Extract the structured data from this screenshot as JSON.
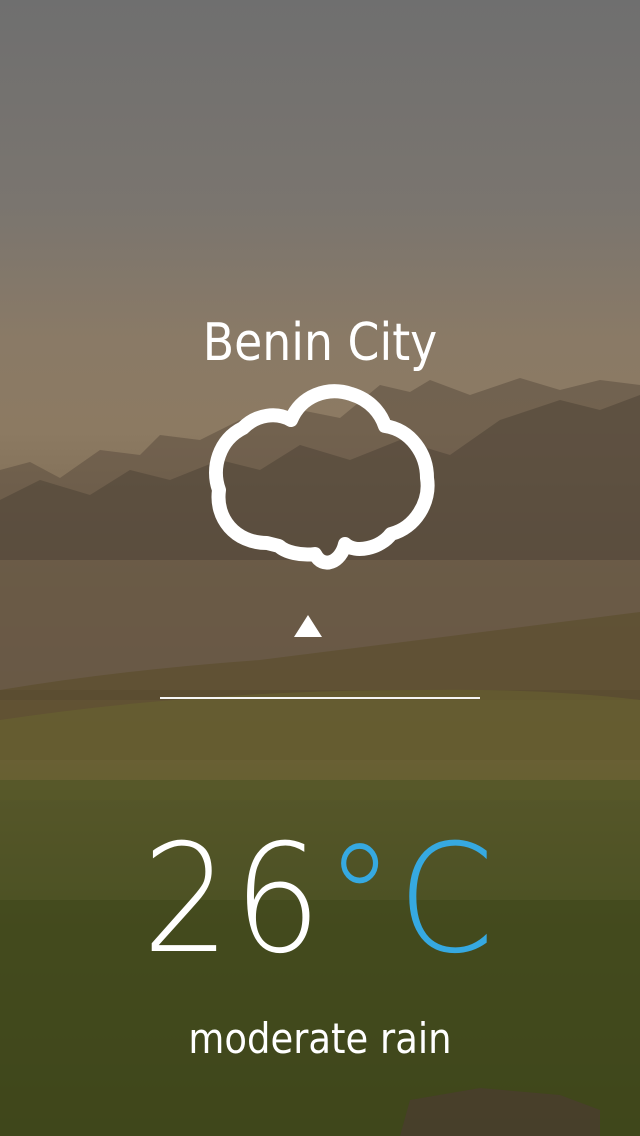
{
  "location": {
    "city": "Benin City"
  },
  "weather": {
    "icon": "cloud-icon",
    "temperature": "26",
    "unit": "°C",
    "condition": "moderate rain"
  },
  "colors": {
    "text": "#ffffff",
    "unit_accent": "#36a9e1"
  }
}
